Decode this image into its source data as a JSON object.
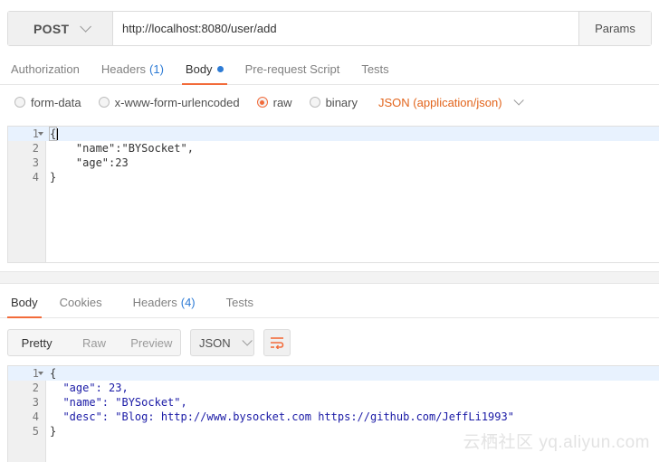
{
  "request": {
    "method": "POST",
    "url": "http://localhost:8080/user/add",
    "params_label": "Params"
  },
  "request_tabs": [
    {
      "label": "Authorization"
    },
    {
      "label": "Headers",
      "count": "(1)"
    },
    {
      "label": "Body"
    },
    {
      "label": "Pre-request Script"
    },
    {
      "label": "Tests"
    }
  ],
  "body_types": [
    "form-data",
    "x-www-form-urlencoded",
    "raw",
    "binary"
  ],
  "selected_body_type": "raw",
  "content_type": "JSON (application/json)",
  "request_lines": [
    {
      "n": "1",
      "text": "{"
    },
    {
      "n": "2",
      "text": "    \"name\":\"BYSocket\","
    },
    {
      "n": "3",
      "text": "    \"age\":23"
    },
    {
      "n": "4",
      "text": "}"
    }
  ],
  "response_tabs": [
    {
      "label": "Body"
    },
    {
      "label": "Cookies"
    },
    {
      "label": "Headers",
      "count": "(4)"
    },
    {
      "label": "Tests"
    }
  ],
  "view_modes": [
    "Pretty",
    "Raw",
    "Preview"
  ],
  "response_format": "JSON",
  "response_lines": [
    {
      "n": "1",
      "text": "{"
    },
    {
      "n": "2",
      "text": "  \"age\": 23,"
    },
    {
      "n": "3",
      "text": "  \"name\": \"BYSocket\","
    },
    {
      "n": "4",
      "text": "  \"desc\": \"Blog: http://www.bysocket.com https://github.com/JeffLi1993\""
    },
    {
      "n": "5",
      "text": "}"
    }
  ],
  "watermark": "云栖社区 yq.aliyun.com",
  "colors": {
    "accent": "#f26b3a",
    "link": "#2d7bd5",
    "content_type": "#e2641b"
  },
  "icons": {
    "method_dropdown": "chevron-down-icon",
    "wrap": "wrap-lines-icon"
  }
}
